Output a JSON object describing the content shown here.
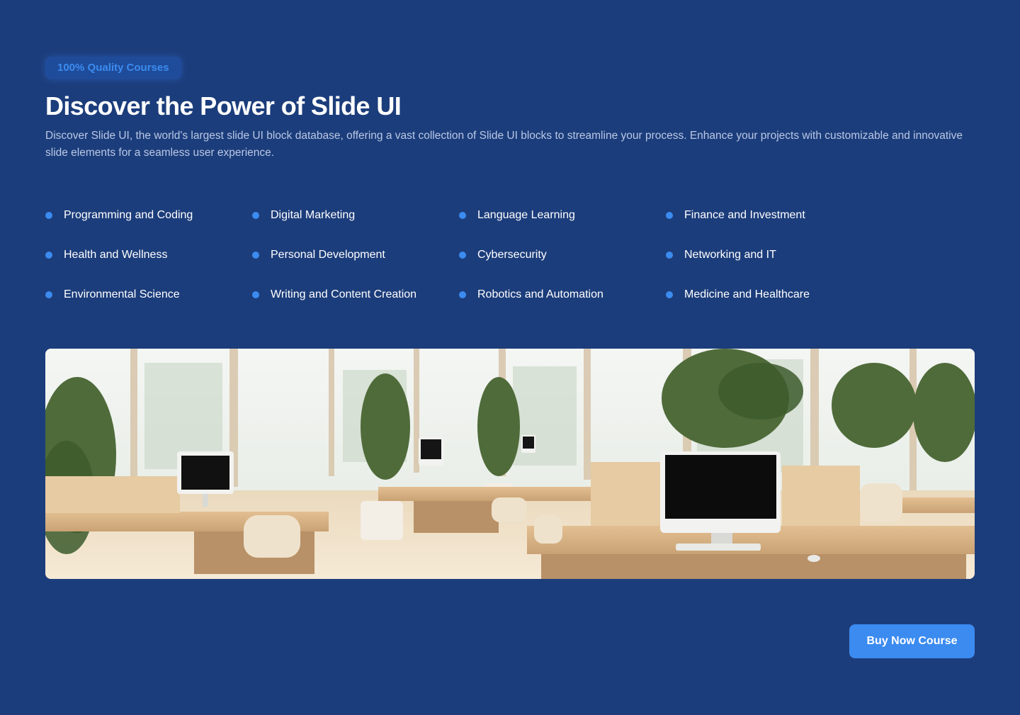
{
  "hero": {
    "badge": "100% Quality Courses",
    "title": "Discover the Power of Slide UI",
    "description": "Discover Slide UI, the world's largest slide UI block database, offering a vast collection of Slide UI blocks to streamline your process. Enhance your projects with customizable and innovative slide elements for a seamless user experience."
  },
  "topics": [
    "Programming and Coding",
    "Digital Marketing",
    "Language Learning",
    "Finance and Investment",
    "Health and Wellness",
    "Personal Development",
    "Cybersecurity",
    "Networking and IT",
    "Environmental Science",
    "Writing and Content Creation",
    "Robotics and Automation",
    "Medicine and Healthcare"
  ],
  "cta": {
    "buy_label": "Buy Now Course"
  },
  "colors": {
    "background": "#1c3d7b",
    "accent": "#3b8bf0",
    "badge_bg": "#1f4c9a",
    "muted_text": "#b9c8e6"
  },
  "image": {
    "subject": "office-workspace-photo"
  }
}
